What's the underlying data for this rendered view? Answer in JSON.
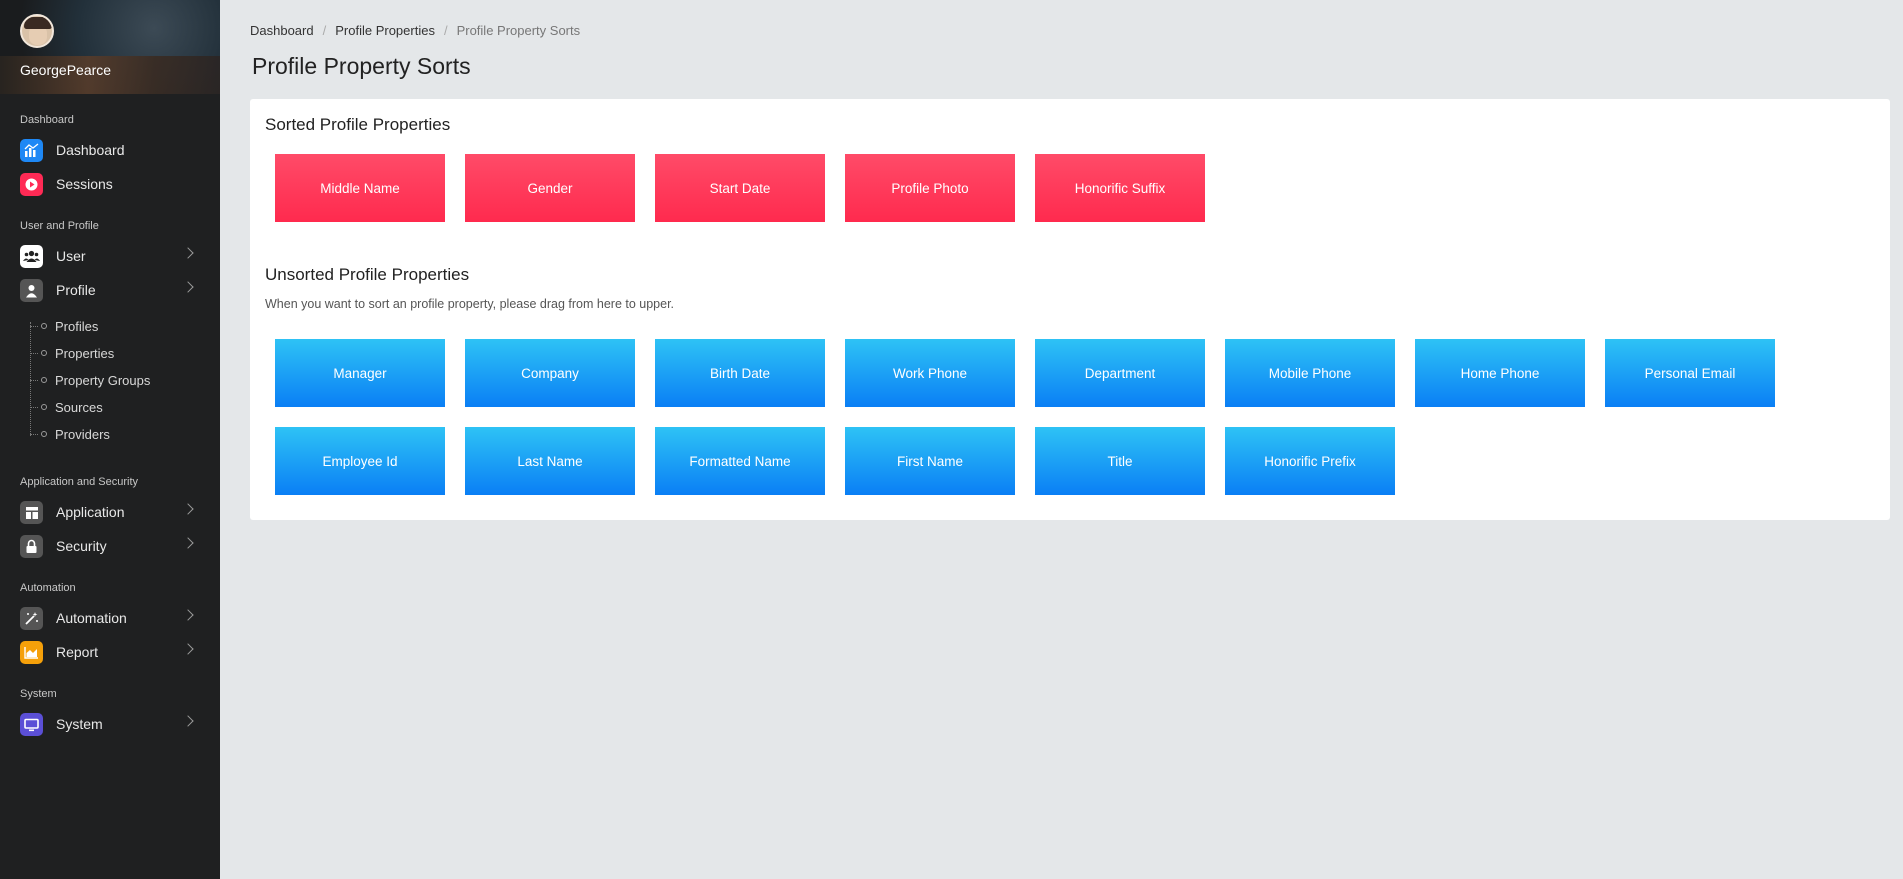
{
  "sidebar": {
    "username": "GeorgePearce",
    "sections": {
      "dashboard": "Dashboard",
      "user_profile": "User and Profile",
      "app_security": "Application and Security",
      "automation": "Automation",
      "system": "System"
    },
    "items": {
      "dashboard": "Dashboard",
      "sessions": "Sessions",
      "user": "User",
      "profile": "Profile",
      "application": "Application",
      "security": "Security",
      "automation": "Automation",
      "report": "Report",
      "system": "System"
    },
    "profile_sub": [
      "Profiles",
      "Properties",
      "Property Groups",
      "Sources",
      "Providers"
    ]
  },
  "breadcrumb": [
    "Dashboard",
    "Profile Properties",
    "Profile Property Sorts"
  ],
  "page_title": "Profile Property Sorts",
  "sorted": {
    "title": "Sorted Profile Properties",
    "items": [
      "Middle Name",
      "Gender",
      "Start Date",
      "Profile Photo",
      "Honorific Suffix"
    ]
  },
  "unsorted": {
    "title": "Unsorted Profile Properties",
    "hint": "When you want to sort an profile property, please drag from here to upper.",
    "items": [
      "Manager",
      "Company",
      "Birth Date",
      "Work Phone",
      "Department",
      "Mobile Phone",
      "Home Phone",
      "Personal Email",
      "Employee Id",
      "Last Name",
      "Formatted Name",
      "First Name",
      "Title",
      "Honorific Prefix"
    ]
  },
  "colors": {
    "sorted_chip": "#ff3558",
    "unsorted_chip": "#1aa4f5",
    "sidebar_bg": "#1f2021"
  }
}
